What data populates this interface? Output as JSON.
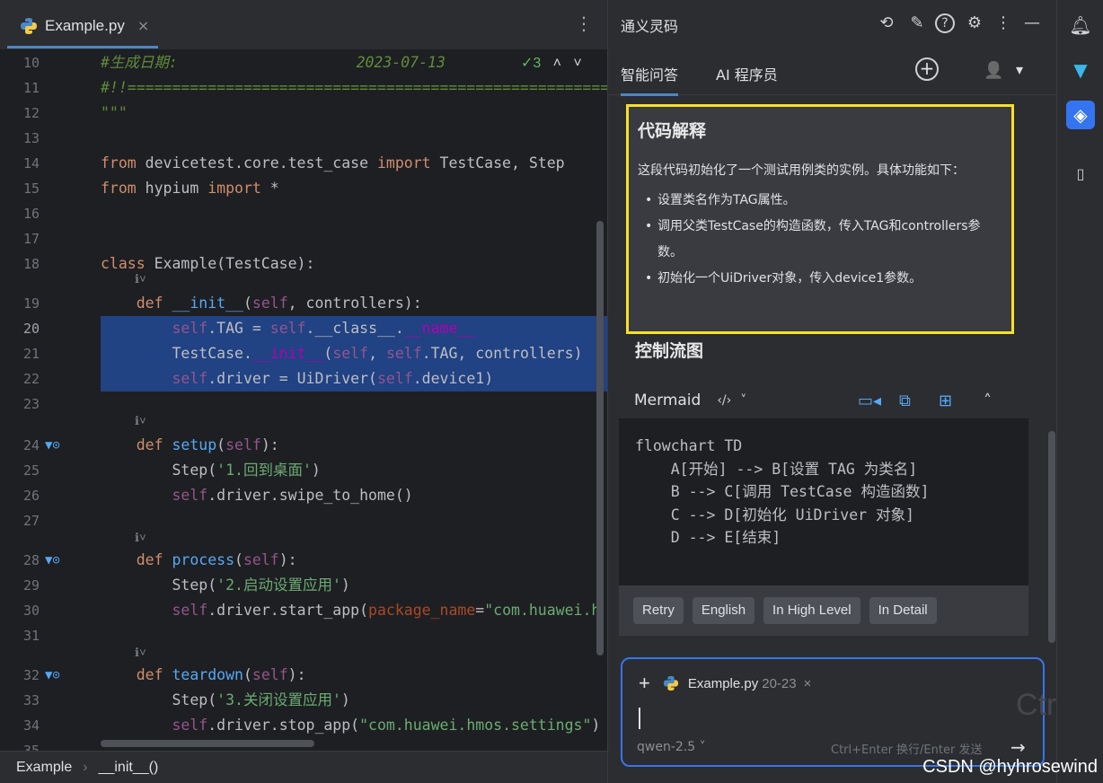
{
  "editor": {
    "tab": {
      "filename": "Example.py",
      "close": "×"
    },
    "tab_menu": "⋮",
    "inspection": {
      "icon": "check-icon",
      "count": "✓3",
      "up": "˄",
      "down": "˅"
    },
    "lines": [
      {
        "n": "10"
      },
      {
        "n": "11"
      },
      {
        "n": "12"
      },
      {
        "n": "13"
      },
      {
        "n": "14"
      },
      {
        "n": "15"
      },
      {
        "n": "16"
      },
      {
        "n": "17"
      },
      {
        "n": "18"
      },
      {
        "n": "19"
      },
      {
        "n": "20"
      },
      {
        "n": "21"
      },
      {
        "n": "22"
      },
      {
        "n": "23"
      },
      {
        "n": "24"
      },
      {
        "n": "25"
      },
      {
        "n": "26"
      },
      {
        "n": "27"
      },
      {
        "n": "28"
      },
      {
        "n": "29"
      },
      {
        "n": "30"
      },
      {
        "n": "31"
      },
      {
        "n": "32"
      },
      {
        "n": "33"
      },
      {
        "n": "34"
      },
      {
        "n": "35"
      }
    ],
    "code": {
      "l10a": "#生成日期:",
      "l10b": "2023-07-13",
      "l11": "#!!=======================================================",
      "l12": "\"\"\"",
      "l14a": "from",
      "l14b": " devicetest.core.test_case ",
      "l14c": "import",
      "l14d": " TestCase, Step",
      "l15a": "from",
      "l15b": " hypium ",
      "l15c": "import",
      "l15d": " *",
      "l18a": "class",
      "l18b": " Example(TestCase):",
      "hint": "ℹ˅",
      "l19a": "def",
      "l19b": "__init__",
      "l19c": "(",
      "l19d": "self",
      "l19e": ", controllers):",
      "l20a": "self",
      "l20b": ".TAG = ",
      "l20c": "self",
      "l20d": ".__class__.",
      "l20e": "__name__",
      "l21a": "TestCase.",
      "l21b": "__init__",
      "l21c": "(",
      "l21d": "self",
      "l21e": ", ",
      "l21f": "self",
      "l21g": ".TAG, controllers)",
      "l22a": "self",
      "l22b": ".driver = UiDriver(",
      "l22c": "self",
      "l22d": ".device1)",
      "l24a": "def",
      "l24b": "setup",
      "l24c": "(",
      "l24d": "self",
      "l24e": "):",
      "l25a": "Step(",
      "l25b": "'1.回到桌面'",
      "l25c": ")",
      "l26a": "self",
      "l26b": ".driver.swipe_to_home()",
      "l28a": "def",
      "l28b": "process",
      "l28c": "(",
      "l28d": "self",
      "l28e": "):",
      "l29a": "Step(",
      "l29b": "'2.启动设置应用'",
      "l29c": ")",
      "l30a": "self",
      "l30b": ".driver.start_app(",
      "l30c": "package_name",
      "l30d": "=",
      "l30e": "\"com.huawei.h",
      "l32a": "def",
      "l32b": "teardown",
      "l32c": "(",
      "l32d": "self",
      "l32e": "):",
      "l33a": "Step(",
      "l33b": "'3.关闭设置应用'",
      "l33c": ")",
      "l34a": "self",
      "l34b": ".driver.stop_app(",
      "l34c": "\"com.huawei.hmos.settings\"",
      "l34d": ")"
    },
    "gutter_icons": "▼⊙",
    "breadcrumb": {
      "item1": "Example",
      "sep": "›",
      "item2": "__init__()"
    }
  },
  "panel": {
    "title": "通义灵码",
    "icons": {
      "history": "⟲",
      "edit": "✎",
      "help": "?",
      "settings": "⚙",
      "more": "⋮",
      "minimize": "—"
    },
    "tabs": [
      {
        "label": "智能问答"
      },
      {
        "label": "AI 程序员"
      }
    ],
    "add": "+",
    "user": "👤",
    "dropdown": "▾",
    "explain": {
      "title": "代码解释",
      "intro": "这段代码初始化了一个测试用例类的实例。具体功能如下：",
      "bullets": [
        "设置类名作为TAG属性。",
        "调用父类TestCase的构造函数，传入TAG和controllers参数。",
        "初始化一个UiDriver对象，传入device1参数。"
      ]
    },
    "flow_title": "控制流图",
    "mermaid": {
      "label": "Mermaid",
      "code_icon": "‹/›",
      "chevron": "˅",
      "collapse": "˄",
      "code": "flowchart TD\n    A[开始] --> B[设置 TAG 为类名]\n    B --> C[调用 TestCase 构造函数]\n    C --> D[初始化 UiDriver 对象]\n    D --> E[结束]"
    },
    "actions": [
      "Retry",
      "English",
      "In High Level",
      "In Detail"
    ],
    "input": {
      "plus": "+",
      "file": "Example.py",
      "range": "20-23",
      "close": "×",
      "ghost": "Ctrl",
      "model": "qwen-2.5 ˅",
      "hint": "Ctrl+Enter 换行/Enter 发送",
      "send": "→"
    }
  },
  "watermark": "CSDN @hyhrosewind",
  "colors": {
    "selection": "#214283",
    "accent": "#3574f0",
    "highlight_border": "#f5e02a"
  }
}
